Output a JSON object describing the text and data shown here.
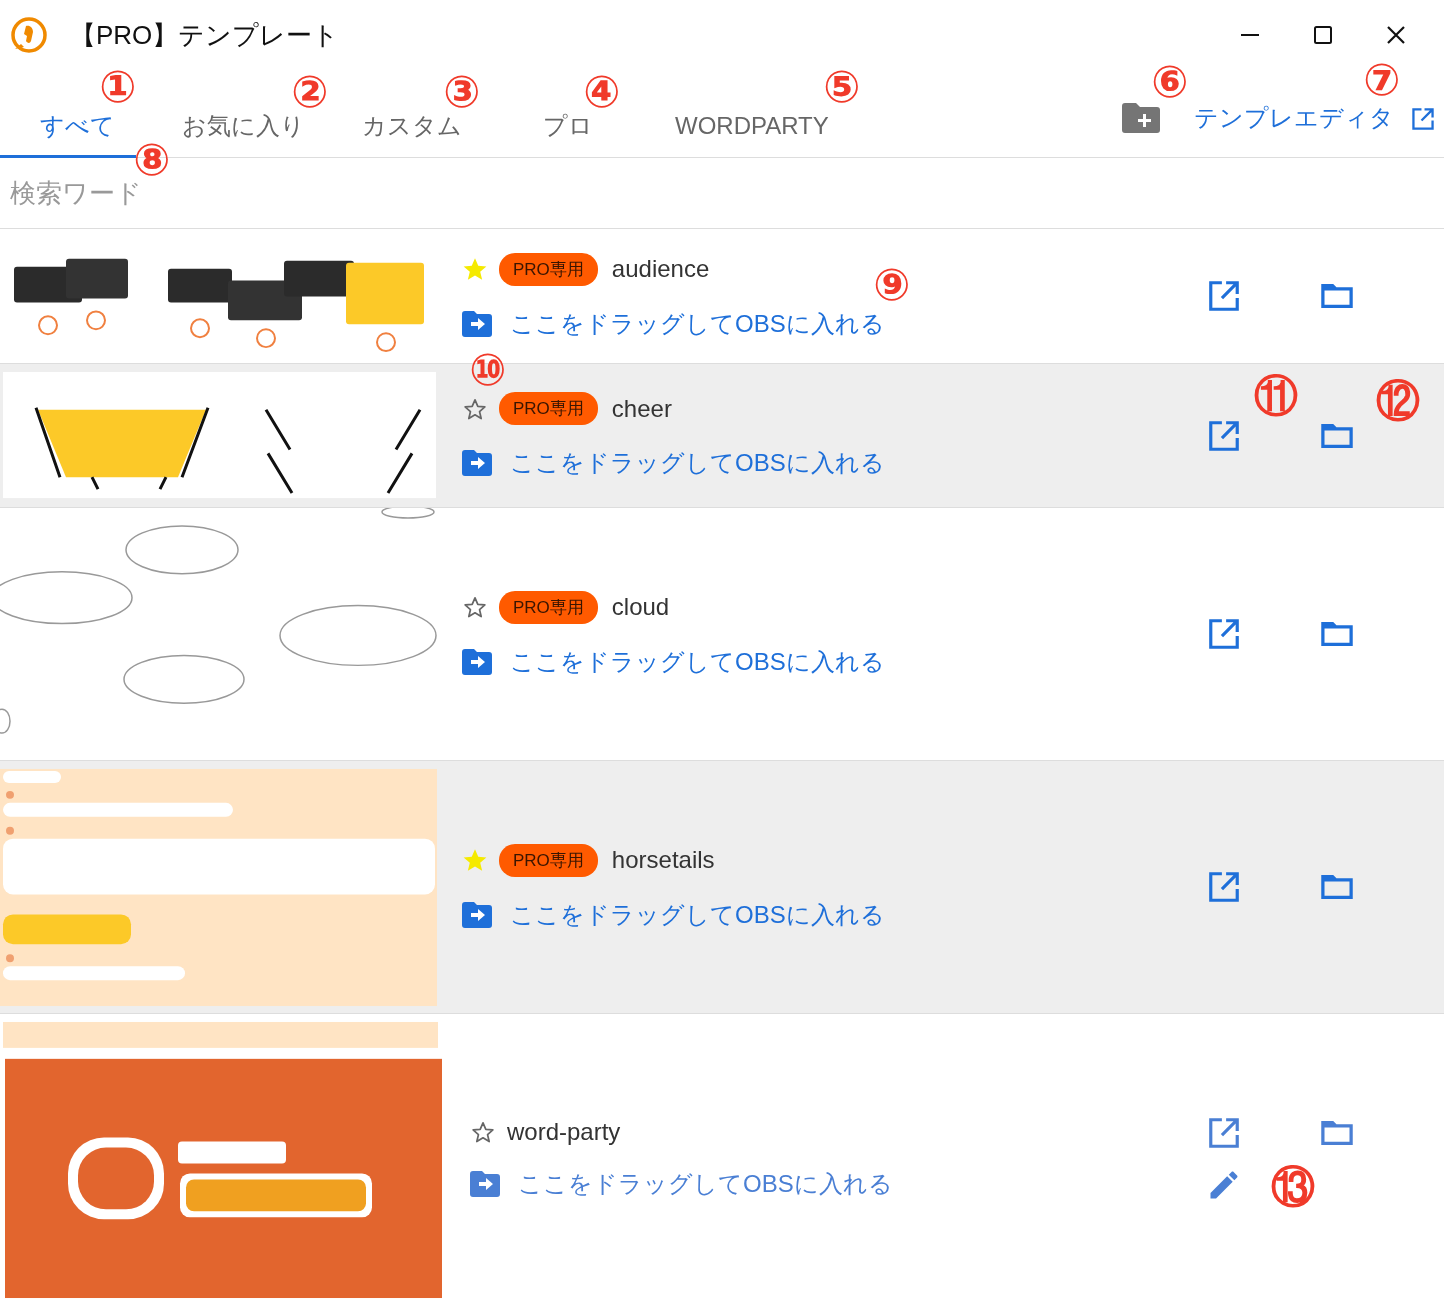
{
  "window": {
    "title": "【PRO】テンプレート"
  },
  "tabs": [
    {
      "label": "すべて",
      "selected": true
    },
    {
      "label": "お気に入り",
      "selected": false
    },
    {
      "label": "カスタム",
      "selected": false
    },
    {
      "label": "プロ",
      "selected": false
    },
    {
      "label": "WORDPARTY",
      "selected": false
    }
  ],
  "toolbar": {
    "editor_link": "テンプレエディタ"
  },
  "search": {
    "placeholder": "検索ワード"
  },
  "templates": [
    {
      "starred": true,
      "badge": "PRO専用",
      "name": "audience",
      "drag_hint": "ここをドラッグしてOBSに入れる",
      "editable": false
    },
    {
      "starred": false,
      "badge": "PRO専用",
      "name": "cheer",
      "drag_hint": "ここをドラッグしてOBSに入れる",
      "editable": false
    },
    {
      "starred": false,
      "badge": "PRO専用",
      "name": "cloud",
      "drag_hint": "ここをドラッグしてOBSに入れる",
      "editable": false
    },
    {
      "starred": true,
      "badge": "PRO専用",
      "name": "horsetails",
      "drag_hint": "ここをドラッグしてOBSに入れる",
      "editable": false
    },
    {
      "starred": false,
      "name": "word-party",
      "drag_hint": "ここをドラッグしてOBSに入れる",
      "editable": true
    }
  ],
  "annotations": [
    "①",
    "②",
    "③",
    "④",
    "⑤",
    "⑥",
    "⑦",
    "⑧",
    "⑨",
    "⑩",
    "⑪",
    "⑫",
    "⑬"
  ]
}
